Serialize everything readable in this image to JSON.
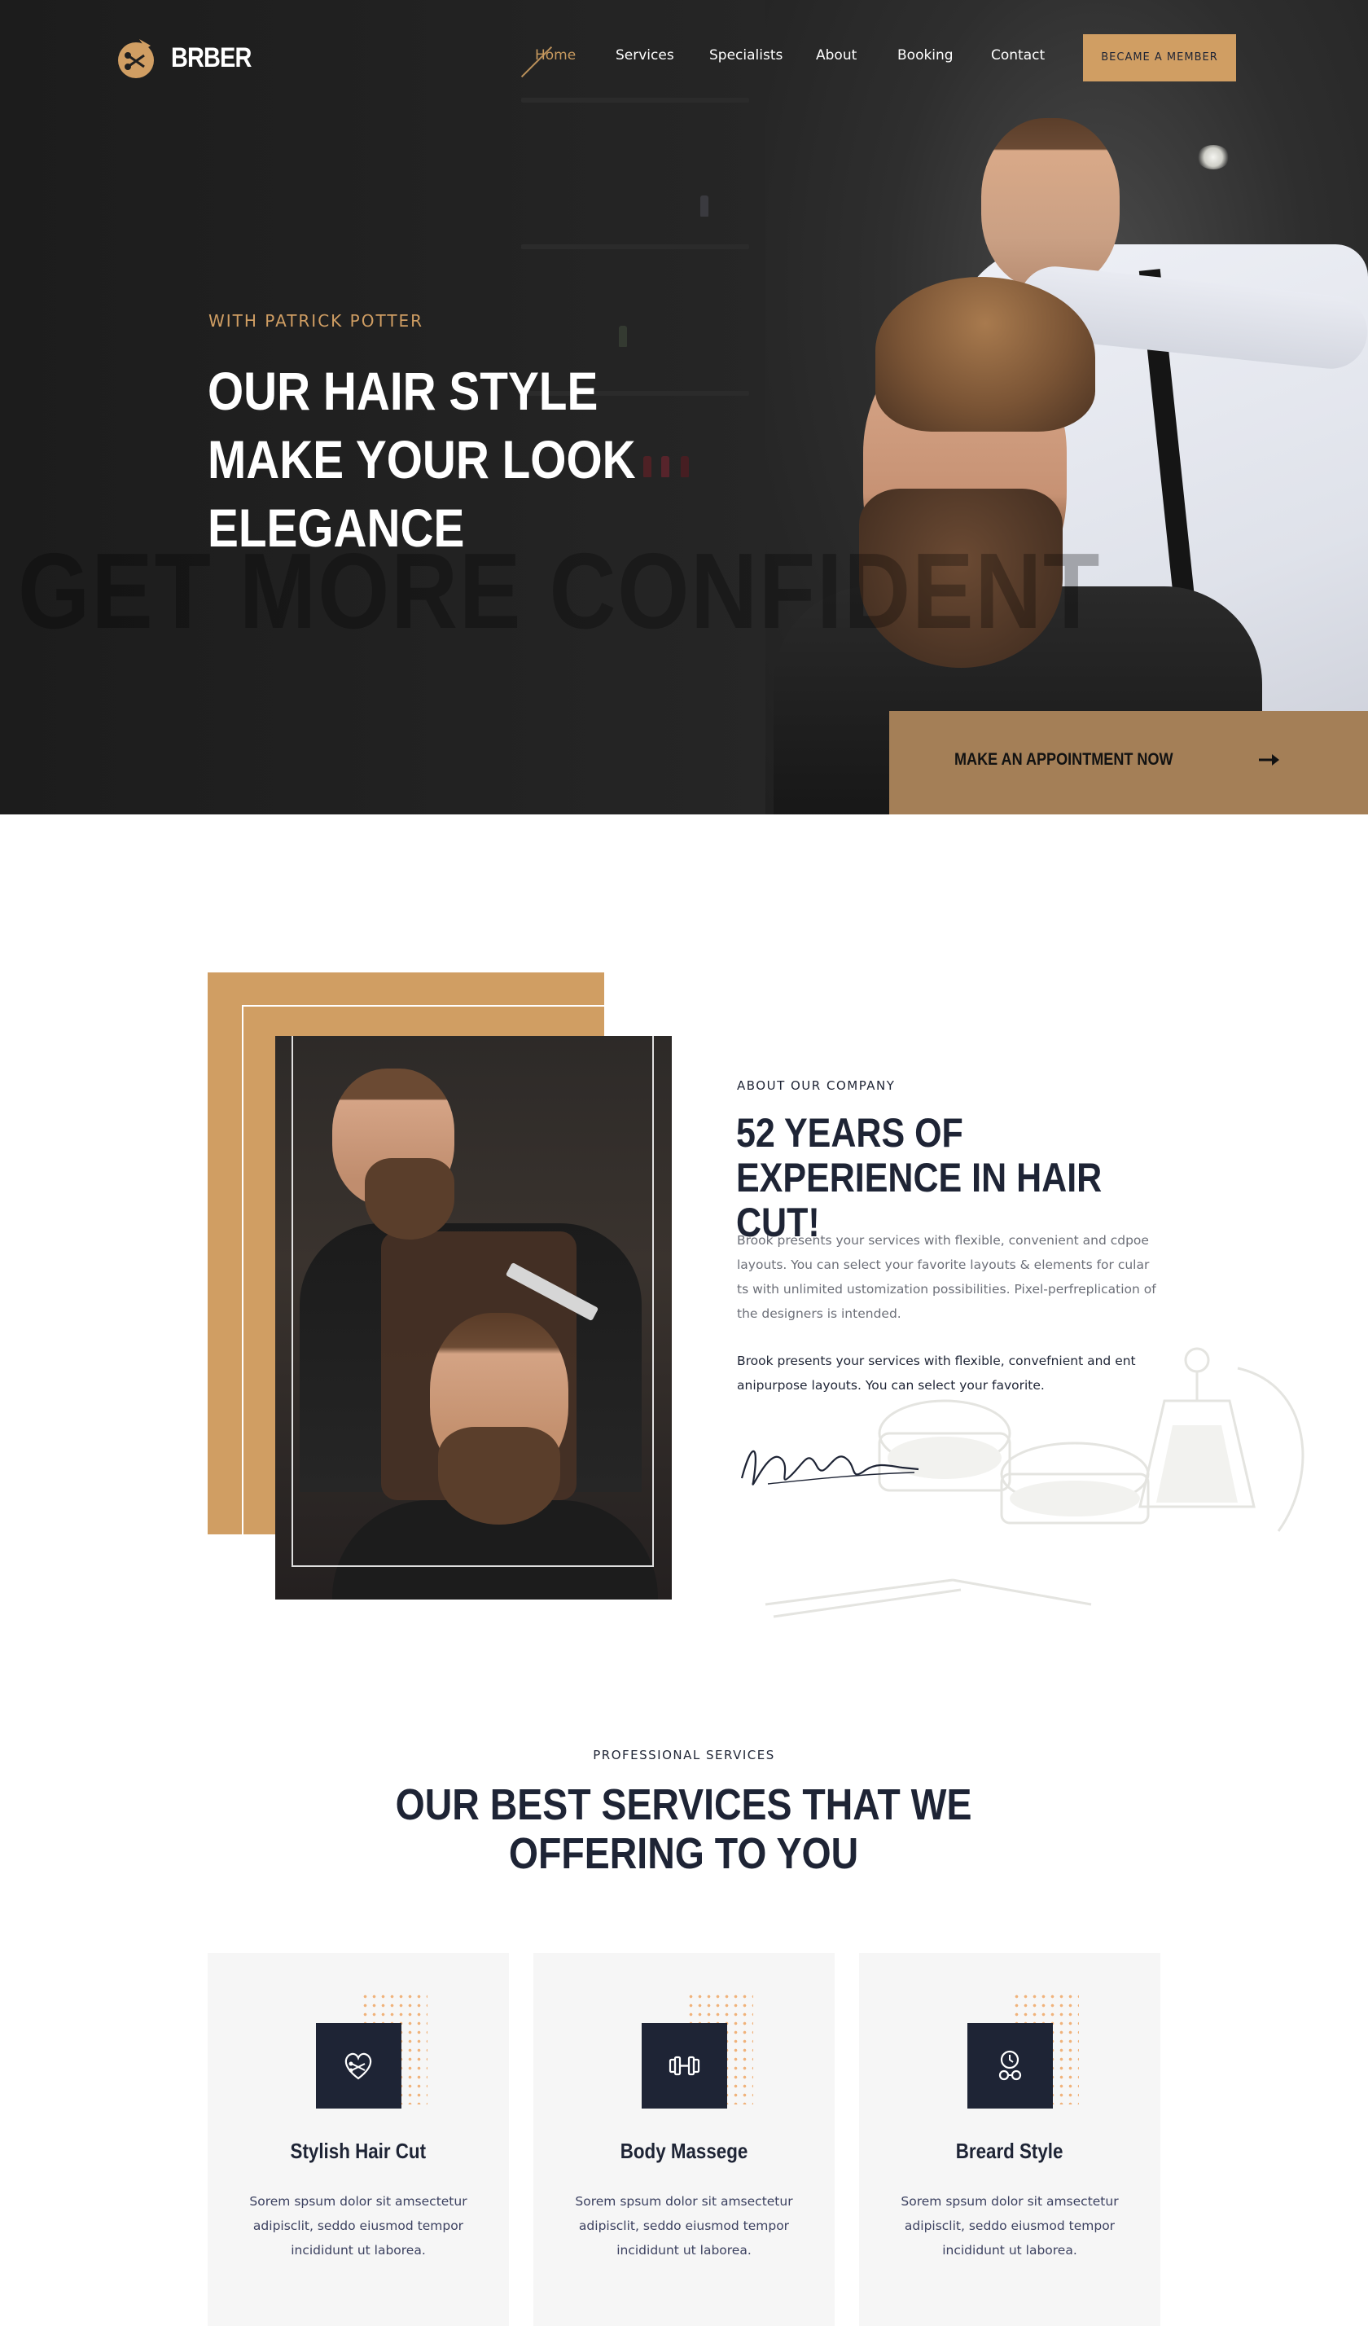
{
  "brand": {
    "name": "BRBER",
    "logo_icon": "scissors-comb-icon",
    "accent": "#d09e63",
    "dark": "#1e2435"
  },
  "nav": {
    "items": [
      {
        "label": "Home",
        "active": true
      },
      {
        "label": "Services"
      },
      {
        "label": "Specialists"
      },
      {
        "label": "About"
      },
      {
        "label": "Booking"
      },
      {
        "label": "Contact"
      }
    ],
    "cta": "BECAME A MEMBER"
  },
  "hero": {
    "kicker": "WITH PATRICK POTTER",
    "title": "OUR HAIR STYLE MAKE YOUR LOOK ELEGANCE",
    "ghost_text": "GET MORE CONFIDENT",
    "appointment_label": "MAKE AN APPOINTMENT NOW",
    "appointment_icon": "arrow-right-icon"
  },
  "about": {
    "kicker": "ABOUT OUR COMPANY",
    "title": "52 YEARS OF EXPERIENCE IN HAIR CUT!",
    "paragraph1": "Brook presents your services with flexible, convenient and cdpoe layouts. You can select your favorite layouts & elements for cular ts with unlimited ustomization possibilities. Pixel-perfreplication of the designers is intended.",
    "paragraph2": "Brook presents your services with flexible, convefnient and ent anipurpose layouts. You can select your favorite."
  },
  "services": {
    "kicker": "PROFESSIONAL SERVICES",
    "title_line1": "OUR BEST SERVICES THAT WE",
    "title_line2": "OFFERING TO YOU",
    "cards": [
      {
        "title": "Stylish Hair Cut",
        "text": "Sorem spsum dolor sit amsectetur adipisclit, seddo eiusmod tempor incididunt ut laborea.",
        "icon": "heart-scissors-icon"
      },
      {
        "title": "Body Massege",
        "text": "Sorem spsum dolor sit amsectetur adipisclit, seddo eiusmod tempor incididunt ut laborea.",
        "icon": "dumbbell-icon"
      },
      {
        "title": "Breard Style",
        "text": "Sorem spsum dolor sit amsectetur adipisclit, seddo eiusmod tempor incididunt ut laborea.",
        "icon": "clock-razor-icon"
      }
    ]
  }
}
